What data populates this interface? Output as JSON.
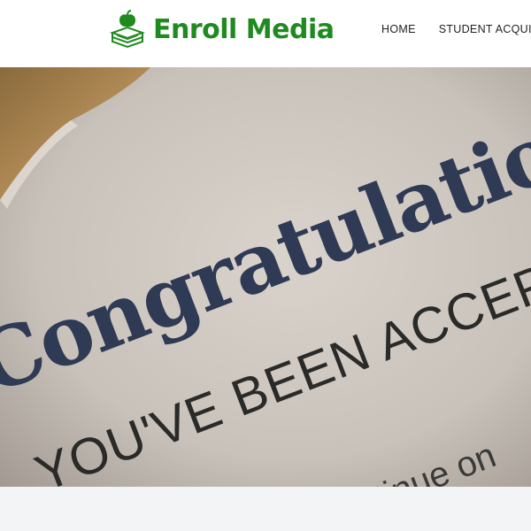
{
  "header": {
    "brand": "Enroll Media",
    "nav": [
      "HOME",
      "STUDENT ACQUISIT"
    ]
  },
  "hero": {
    "headline": "Congratulations",
    "subline": "YOU'VE BEEN ACCEPT",
    "footnote": "tinue on"
  },
  "colors": {
    "brand_green": "#1f8a1f",
    "headline_ink": "#2f3a55"
  },
  "icons": {
    "logo": "apple-on-books-icon"
  }
}
